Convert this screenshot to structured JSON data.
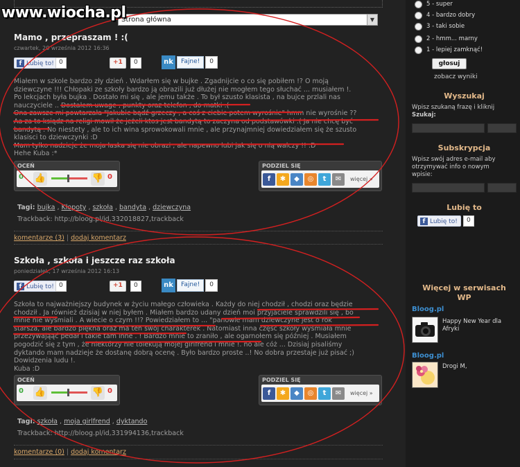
{
  "watermark": "www.wiocha.pl",
  "select": {
    "value": "Strona główna"
  },
  "posts": [
    {
      "title": "Mamo , przepraszam ! :(",
      "date": "czwartek, 20 września 2012 16:36",
      "fb_like": "Lubię to!",
      "fb_count": "0",
      "gplus": "+1",
      "gplus_count": "0",
      "nk_logo": "nk",
      "nk_label": "Fajne!",
      "nk_count": "0",
      "body": [
        "Miałem w szkole bardzo zły dzień . Wdarłem się w bujke . Zgadnijcie o co się pobiłem !? O moją",
        "dziewczyne !!! Chłopaki ze szkoły bardzo ją obrazili już dłużej nie mogłem tego słuchać ... musiałem !.",
        "Po lekcjach była bujka . Dostało mi się , ale jemu także . To był szusto klasista , na bujce przlali nas",
        "nauczyciele .. Dostałem uwage , punkty oraz telefon , do matki :(",
        "Ona zawsze mi powtarzała \"Jakubie bądź grzeczy , a coś z ciebie potem wyrośnie\" hmm nie wyrośnie ??",
        "Aa za to ksiądz na religi mowił że jeżeli ktos jest bandytą to zaczyna od podstawówki :( Ja nie chcę być",
        "bandytą . No niestety , ale to ich wina sprowokowali mnie , ale przynajmniej dowiedziałem się że szusto",
        "klasisci to dziewczynki :D",
        "Mam tylko nadzieje że moja laska się nie obrazi , ale napewno lubi jak się o nią walczy !! :D",
        "Hehe Kuba :*"
      ],
      "rating_label": "OCEŃ",
      "rating_up": "0",
      "rating_down": "0",
      "share_label": "PODZIEL SIĘ",
      "share_more": "więcej »",
      "tags_label": "Tagi:",
      "tags": [
        "bujka",
        "Kłopoty",
        "szkoła",
        "bandyta",
        "dziewczyna"
      ],
      "trackback": "Trackback: http://bloog.pl/id,332018827,trackback",
      "comments_link": "komentarze (3)",
      "add_comment": "dodaj komentarz"
    },
    {
      "title": "Szkoła , szkoła i jeszcze raz szkoła",
      "date": "poniedziałek, 17 września 2012 16:13",
      "fb_like": "Lubię to!",
      "fb_count": "0",
      "gplus": "+1",
      "gplus_count": "0",
      "nk_logo": "nk",
      "nk_label": "Fajne!",
      "nk_count": "0",
      "body": [
        "Szkoła to najważniejszy budynek w życiu małego człowieka . Każdy do niej chodził , chodzi oraz będzie",
        "chodził . Ja również dzisiaj w niej byłem . Miałem bardzo udany dzień moi przyjaciele sprawdzili się , bo",
        "mnie nie wyśmiali . A wiecie o czym !!? Powiedziałem to ... \"panowie mam dziewczyne jest o rok",
        "starsza, ale bardzo piękna oraz ma ten swój charakterek . Natomiast inna część szkoły wyśmiała mnie",
        "przezywająąć pedał i takie tam inne . ! Bardzo mnie to zraniło , ale ogarnołem się później . Musiałem",
        "pogodzić się z tym , że niektórzy nie tolekują mojej girlfrend i mnie !. no ale cóż ... Dzisiaj pisaliśmy",
        "dyktando mam nadzieje że dostanę dobrą ocenę . Było bardzo proste ..! No dobra przestaje już pisać ;)",
        "Dowidzenia ludu !.",
        "Kuba :D"
      ],
      "rating_label": "OCEŃ",
      "rating_up": "0",
      "rating_down": "0",
      "share_label": "PODZIEL SIĘ",
      "share_more": "więcej »",
      "tags_label": "Tagi:",
      "tags": [
        "szkoła",
        "moja girlfrend",
        "dyktando"
      ],
      "trackback": "Trackback: http://bloog.pl/id,331994136,trackback",
      "comments_link": "komentarze (0)",
      "add_comment": "dodaj komentarz"
    }
  ],
  "sidebar": {
    "poll": [
      {
        "num": "5",
        "label": "super"
      },
      {
        "num": "4",
        "label": "bardzo dobry"
      },
      {
        "num": "3",
        "label": "taki sobie"
      },
      {
        "num": "2",
        "label": "hmm... marny"
      },
      {
        "num": "1",
        "label": "lepiej zamknąć!"
      }
    ],
    "vote_button": "głosuj",
    "results_link": "zobacz wyniki",
    "search": {
      "heading": "Wyszukaj",
      "text": "Wpisz szukaną frazę i kliknij",
      "label": "Szukaj:"
    },
    "subscription": {
      "heading": "Subskrypcja",
      "text": [
        "Wpisz swój adres e-mail aby",
        "otrzymywać info o nowym",
        "wpisie:"
      ]
    },
    "like": {
      "heading": "Lubię to",
      "button": "Lubię to!",
      "count": "0"
    },
    "more": {
      "heading_line1": "Więcej w serwisach",
      "heading_line2": "WP",
      "items": [
        {
          "source": "Bloog.pl",
          "caption_line1": "Happy New Year dla",
          "caption_line2": "Afryki"
        },
        {
          "source": "Bloog.pl",
          "caption_line1": "Drogi M,",
          "caption_line2": ""
        }
      ]
    }
  }
}
